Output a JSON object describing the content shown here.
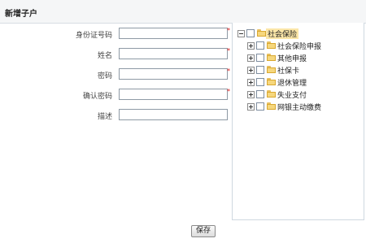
{
  "header": {
    "title": "新增子户"
  },
  "form": {
    "fields": [
      {
        "label": "身份证号码",
        "value": "",
        "required": "*"
      },
      {
        "label": "姓名",
        "value": "",
        "required": "*"
      },
      {
        "label": "密码",
        "value": "",
        "required": "*"
      },
      {
        "label": "确认密码",
        "value": "",
        "required": "*"
      },
      {
        "label": "描述",
        "value": "",
        "required": ""
      }
    ]
  },
  "tree": {
    "root": {
      "label": "社会保险",
      "expander": "minus"
    },
    "children": [
      {
        "label": "社会保险申报",
        "expander": "plus"
      },
      {
        "label": "其他申报",
        "expander": "plus"
      },
      {
        "label": "社保卡",
        "expander": "plus"
      },
      {
        "label": "退休管理",
        "expander": "plus"
      },
      {
        "label": "失业支付",
        "expander": "plus"
      },
      {
        "label": "网银主动缴费",
        "expander": "plus"
      }
    ]
  },
  "actions": {
    "save_label": "保存"
  },
  "colors": {
    "required": "#e02020",
    "folder": "#f6d77d",
    "root_highlight": "#fbe6a8"
  }
}
